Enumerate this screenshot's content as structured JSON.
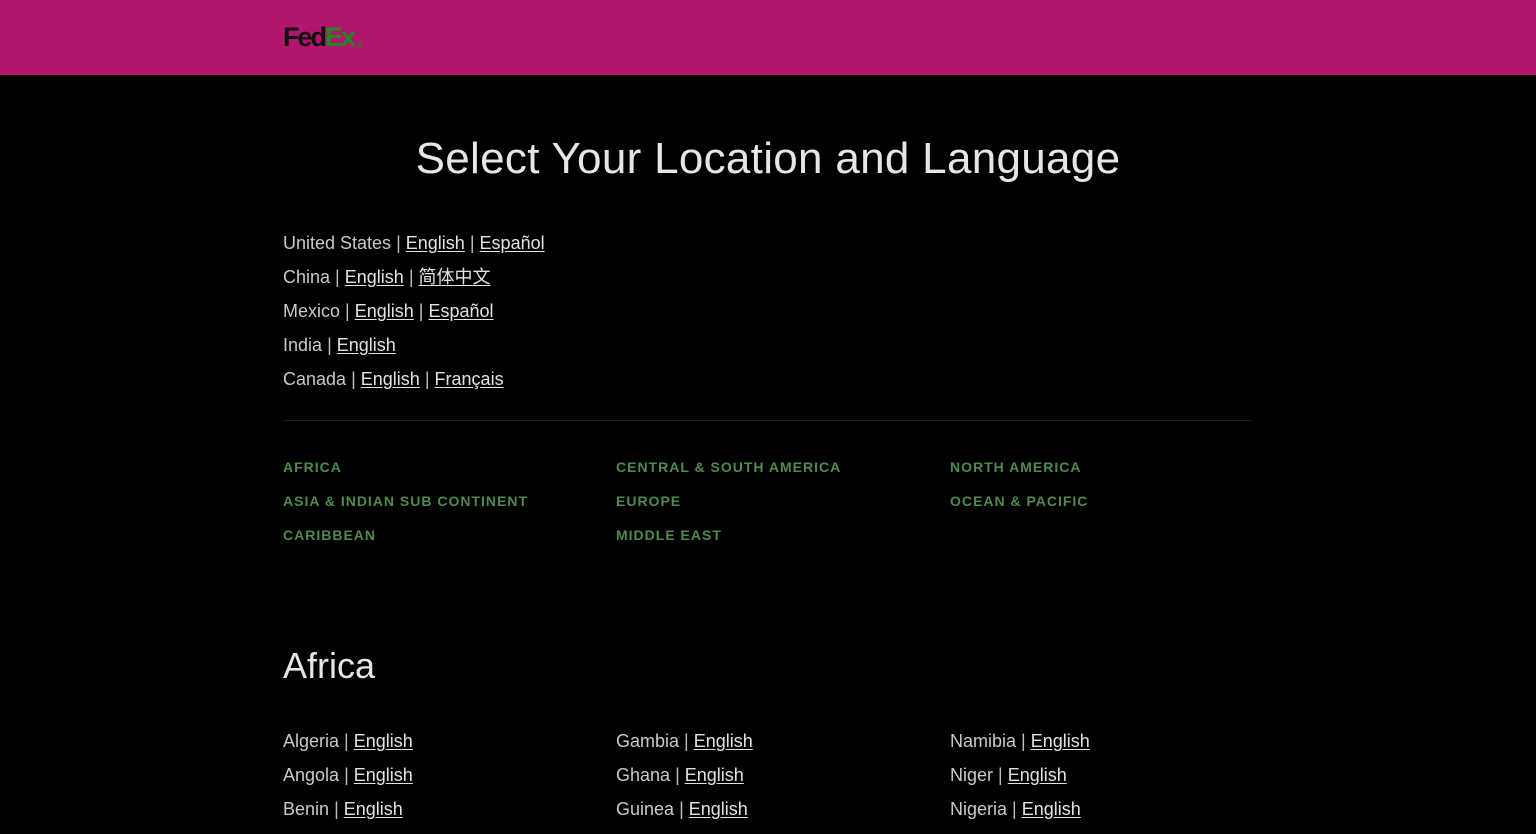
{
  "header": {
    "logo_fed": "Fed",
    "logo_ex": "Ex",
    "logo_reg": "®",
    "background_color": "#b3166f"
  },
  "page_title": "Select Your Location and Language",
  "separator": "|",
  "featured_countries": [
    {
      "country": "United States",
      "languages": [
        "English",
        "Español"
      ]
    },
    {
      "country": "China",
      "languages": [
        "English",
        "简体中文"
      ]
    },
    {
      "country": "Mexico",
      "languages": [
        "English",
        "Español"
      ]
    },
    {
      "country": "India",
      "languages": [
        "English"
      ]
    },
    {
      "country": "Canada",
      "languages": [
        "English",
        "Français"
      ]
    }
  ],
  "regions": [
    [
      "AFRICA",
      "ASIA & INDIAN SUB CONTINENT",
      "CARIBBEAN"
    ],
    [
      "CENTRAL & SOUTH AMERICA",
      "EUROPE",
      "MIDDLE EAST"
    ],
    [
      "NORTH AMERICA",
      "OCEAN & PACIFIC"
    ]
  ],
  "africa": {
    "title": "Africa",
    "columns": [
      [
        {
          "country": "Algeria",
          "languages": [
            "English"
          ]
        },
        {
          "country": "Angola",
          "languages": [
            "English"
          ]
        },
        {
          "country": "Benin",
          "languages": [
            "English"
          ]
        }
      ],
      [
        {
          "country": "Gambia",
          "languages": [
            "English"
          ]
        },
        {
          "country": "Ghana",
          "languages": [
            "English"
          ]
        },
        {
          "country": "Guinea",
          "languages": [
            "English"
          ]
        }
      ],
      [
        {
          "country": "Namibia",
          "languages": [
            "English"
          ]
        },
        {
          "country": "Niger",
          "languages": [
            "English"
          ]
        },
        {
          "country": "Nigeria",
          "languages": [
            "English"
          ]
        }
      ]
    ]
  },
  "colors": {
    "region_link": "#4f8a4f",
    "background": "#000000"
  }
}
